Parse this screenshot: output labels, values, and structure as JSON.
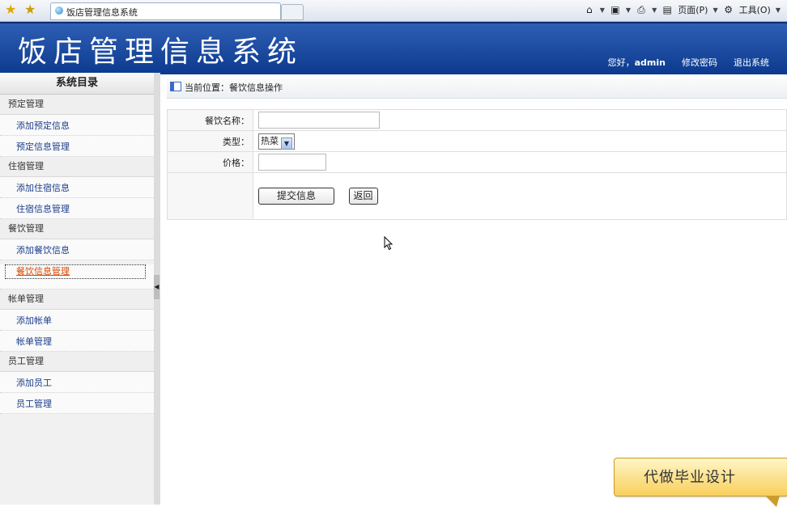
{
  "browser": {
    "tab_title": "饭店管理信息系统",
    "toolbar": {
      "page_label": "页面(P)",
      "tools_label": "工具(O)"
    }
  },
  "header": {
    "app_title": "饭店管理信息系统",
    "greeting": "您好，",
    "username": "admin",
    "change_password": "修改密码",
    "logout": "退出系统"
  },
  "sidebar": {
    "title": "系统目录",
    "groups": [
      {
        "label": "预定管理",
        "items": [
          "添加预定信息",
          "预定信息管理"
        ]
      },
      {
        "label": "住宿管理",
        "items": [
          "添加住宿信息",
          "住宿信息管理"
        ]
      },
      {
        "label": "餐饮管理",
        "items": [
          "添加餐饮信息",
          "餐饮信息管理"
        ]
      },
      {
        "label": "帐单管理",
        "items": [
          "添加帐单",
          "帐单管理"
        ]
      },
      {
        "label": "员工管理",
        "items": [
          "添加员工",
          "员工管理"
        ]
      }
    ],
    "active_item": "餐饮信息管理"
  },
  "breadcrumb": {
    "text": "当前位置：餐饮信息操作"
  },
  "form": {
    "name_label": "餐饮名称：",
    "name_value": "",
    "type_label": "类型：",
    "type_value": "热菜",
    "price_label": "价格：",
    "price_value": "",
    "submit_label": "提交信息",
    "back_label": "返回"
  },
  "promo": {
    "text": "代做毕业设计"
  },
  "colors": {
    "header_blue": "#0b3a8f",
    "active_link": "#d84a00",
    "link": "#1b3d8a"
  }
}
